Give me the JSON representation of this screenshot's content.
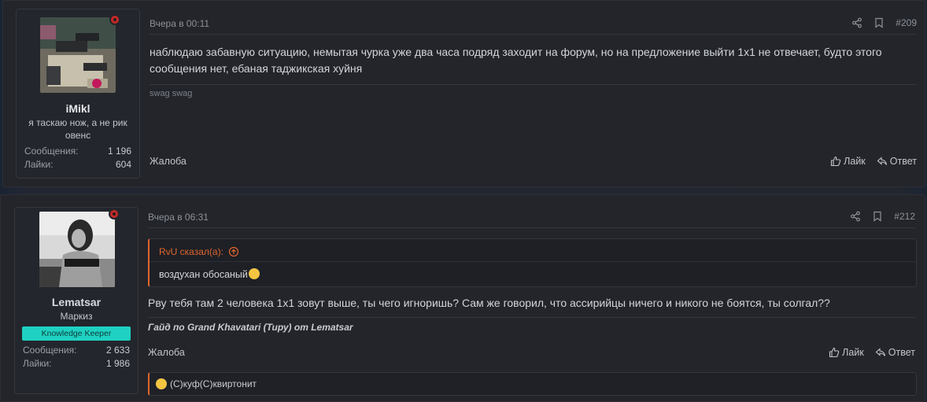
{
  "posts": [
    {
      "username": "iMikl",
      "user_title": "я таскаю нож, а не рик овенс",
      "badge": "",
      "stats": [
        {
          "label": "Сообщения:",
          "value": "1 196"
        },
        {
          "label": "Лайки:",
          "value": "604"
        }
      ],
      "time": "Вчера в 00:11",
      "post_number": "#209",
      "message": "наблюдаю забавную ситуацию, немытая чурка уже два часа подряд заходит на форум, но на предложение выйти 1х1 не отвечает, будто этого сообщения нет, ебаная таджикская хуйня",
      "signature": "swag swag",
      "report_label": "Жалоба",
      "like_label": "Лайк",
      "reply_label": "Ответ"
    },
    {
      "username": "Lematsar",
      "user_title": "Маркиз",
      "badge": "Knowledge Keeper",
      "stats": [
        {
          "label": "Сообщения:",
          "value": "2 633"
        },
        {
          "label": "Лайки:",
          "value": "1 986"
        }
      ],
      "time": "Вчера в 06:31",
      "post_number": "#212",
      "quote": {
        "author": "RvU сказал(а):",
        "text": "воздухан обосаный"
      },
      "message": "Рву тебя там 2 человека 1х1 зовут выше, ты чего игноришь? Сам же говорил, что ассирийцы ничего и никого не боятся, ты солгал??",
      "signature": "Гайд по Grand Khavatari (Тиру) от Lematsar",
      "report_label": "Жалоба",
      "like_label": "Лайк",
      "reply_label": "Ответ",
      "reactions": "(С)куф(С)квиртонит"
    }
  ],
  "colors": {
    "accent": "#e0652c",
    "badge": "#1fd1c2",
    "online": "#c62828"
  }
}
